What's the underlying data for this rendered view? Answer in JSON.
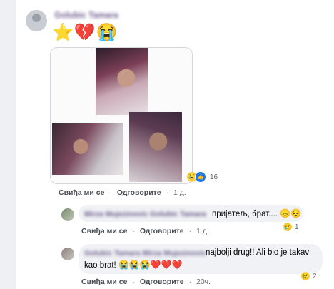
{
  "post": {
    "author_name": "Golubic Tamara",
    "emoji_line": "⭐💔😭",
    "reaction_icons": [
      "crying-face-icon",
      "like-icon"
    ],
    "reaction_count": "16",
    "actions": {
      "like": "Свиђа ми се",
      "reply": "Одговорите",
      "time": "1 д."
    }
  },
  "replies": [
    {
      "author_name": "Mirza Mujezinovic Golubic Tamara",
      "text": "пријатељ, брат....",
      "emojis": "😞😣",
      "reaction_count": "1",
      "actions": {
        "like": "Свиђа ми се",
        "reply": "Одговорите",
        "time": "1 д."
      }
    },
    {
      "author_name": "Golubic Tamara Mirza Mujezinovic",
      "text_line1": "najbolji drug!! Ali bio je takav",
      "text_line2": "kao brat!",
      "emojis": "😭😭😭❤️❤️❤️",
      "reaction_count": "2",
      "actions": {
        "like": "Свиђа ми се",
        "reply": "Одговорите",
        "time": "20ч."
      }
    }
  ],
  "separator": "·",
  "colors": {
    "background": "#eef0f4",
    "bubble": "#f0f2f5",
    "like_blue": "#1877f2",
    "name": "#6a5a8a"
  }
}
